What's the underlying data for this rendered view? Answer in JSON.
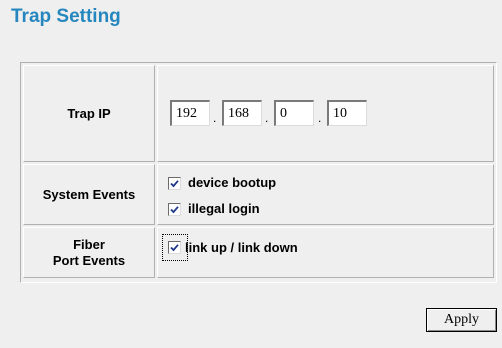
{
  "page": {
    "title": "Trap Setting"
  },
  "trap_ip": {
    "label": "Trap IP",
    "octets": [
      "192",
      "168",
      "0",
      "10"
    ],
    "separator": "."
  },
  "system_events": {
    "label": "System Events",
    "options": [
      {
        "label": "device bootup",
        "checked": true
      },
      {
        "label": "illegal login",
        "checked": true
      }
    ]
  },
  "fiber_port_events": {
    "label_line1": "Fiber",
    "label_line2": "Port Events",
    "options": [
      {
        "label": "link up / link down",
        "checked": true
      }
    ]
  },
  "actions": {
    "apply_label": "Apply"
  },
  "colors": {
    "title": "#2687bf",
    "background": "#efefef",
    "checkmark": "#1f3a8a"
  },
  "icons": {
    "checkbox_mark": "check-icon"
  }
}
